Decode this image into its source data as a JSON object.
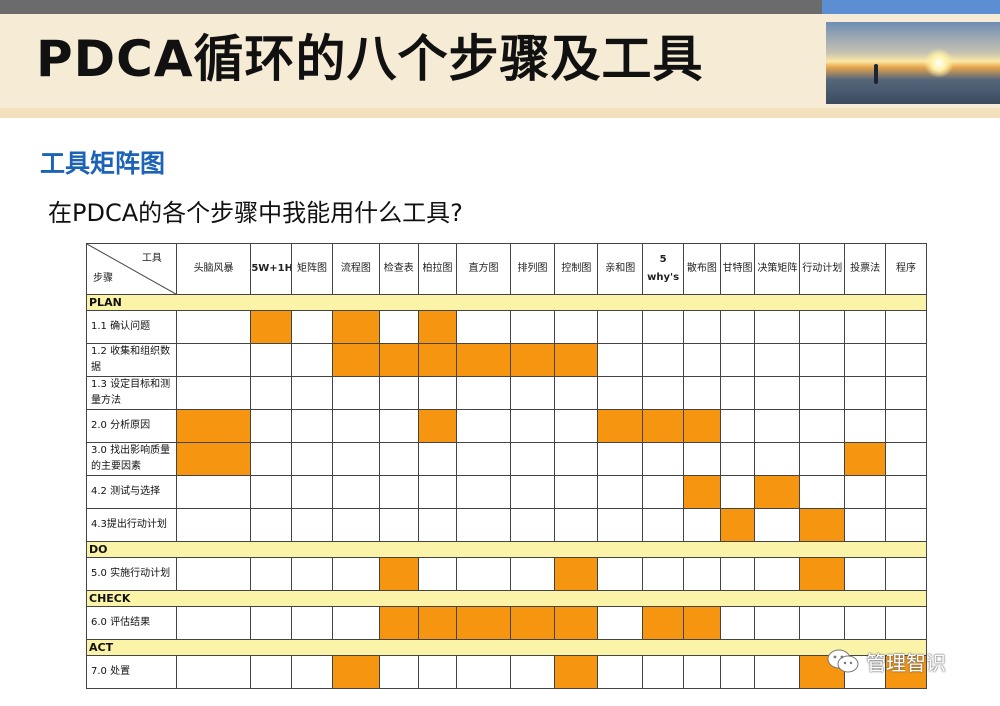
{
  "slide": {
    "title": "PDCA循环的八个步骤及工具",
    "subtitle": "工具矩阵图",
    "question": "在PDCA的各个步骤中我能用什么工具?",
    "watermark": "管理智识",
    "photo_icon": "sunset-landscape-photo",
    "watermark_icon": "wechat-icon"
  },
  "colors": {
    "highlight": "#f6950f",
    "section_bg": "#fbf3a7",
    "title_band": "#f6ecd6",
    "subtitle": "#1c63b8"
  },
  "table": {
    "corner_top": "工具",
    "corner_bottom": "步骤",
    "columns": [
      {
        "label": "头脑风暴"
      },
      {
        "label": "5W+1H"
      },
      {
        "label": "矩阵图"
      },
      {
        "label": "流程图"
      },
      {
        "label": "检查表"
      },
      {
        "label": "柏拉图"
      },
      {
        "label": "直方图"
      },
      {
        "label": "排列图"
      },
      {
        "label": "控制图"
      },
      {
        "label": "亲和图"
      },
      {
        "label": "5 why's"
      },
      {
        "label": "散布图"
      },
      {
        "label": "甘特图"
      },
      {
        "label": "决策矩阵"
      },
      {
        "label": "行动计划"
      },
      {
        "label": "投票法"
      },
      {
        "label": "程序"
      }
    ],
    "sections": [
      {
        "name": "PLAN",
        "rows": [
          {
            "label": "1.1 确认问题",
            "marks": [
              0,
              1,
              0,
              1,
              0,
              1,
              0,
              0,
              0,
              0,
              0,
              0,
              0,
              0,
              0,
              0,
              0
            ]
          },
          {
            "label": "1.2 收集和组织数据",
            "marks": [
              0,
              0,
              0,
              1,
              1,
              1,
              1,
              1,
              1,
              0,
              0,
              0,
              0,
              0,
              0,
              0,
              0
            ]
          },
          {
            "label": "1.3 设定目标和测量方法",
            "marks": [
              0,
              0,
              0,
              0,
              0,
              0,
              0,
              0,
              0,
              0,
              0,
              0,
              0,
              0,
              0,
              0,
              0
            ]
          },
          {
            "label": "2.0 分析原因",
            "marks": [
              1,
              0,
              0,
              0,
              0,
              1,
              0,
              0,
              0,
              1,
              1,
              1,
              0,
              0,
              0,
              0,
              0
            ]
          },
          {
            "label": "3.0 找出影响质量的主要因素",
            "marks": [
              1,
              0,
              0,
              0,
              0,
              0,
              0,
              0,
              0,
              0,
              0,
              0,
              0,
              0,
              0,
              1,
              0
            ]
          },
          {
            "label": "4.2 测试与选择",
            "marks": [
              0,
              0,
              0,
              0,
              0,
              0,
              0,
              0,
              0,
              0,
              0,
              1,
              0,
              1,
              0,
              0,
              0
            ]
          },
          {
            "label": "4.3提出行动计划",
            "marks": [
              0,
              0,
              0,
              0,
              0,
              0,
              0,
              0,
              0,
              0,
              0,
              0,
              1,
              0,
              1,
              0,
              0
            ]
          }
        ]
      },
      {
        "name": "DO",
        "rows": [
          {
            "label": "5.0 实施行动计划",
            "marks": [
              0,
              0,
              0,
              0,
              1,
              0,
              0,
              0,
              1,
              0,
              0,
              0,
              0,
              0,
              1,
              0,
              0
            ]
          }
        ]
      },
      {
        "name": "CHECK",
        "rows": [
          {
            "label": "6.0 评估结果",
            "marks": [
              0,
              0,
              0,
              0,
              1,
              1,
              1,
              1,
              1,
              0,
              1,
              1,
              0,
              0,
              0,
              0,
              0
            ]
          }
        ]
      },
      {
        "name": "ACT",
        "rows": [
          {
            "label": "7.0 处置",
            "marks": [
              0,
              0,
              0,
              1,
              0,
              0,
              0,
              0,
              1,
              0,
              0,
              0,
              0,
              0,
              1,
              0,
              1
            ]
          }
        ]
      }
    ]
  }
}
